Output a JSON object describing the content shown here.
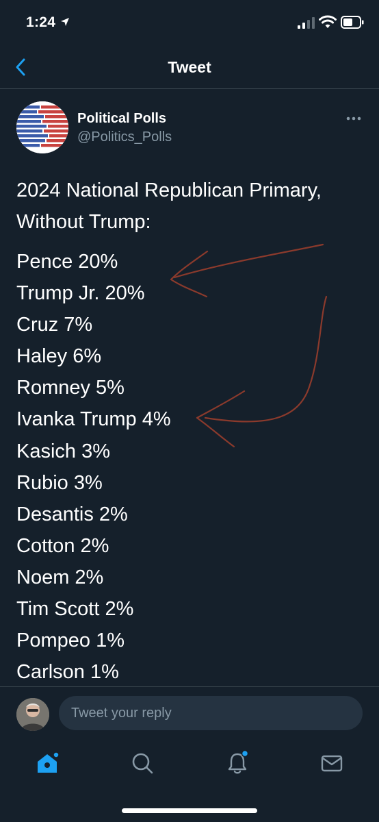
{
  "status_bar": {
    "time": "1:24"
  },
  "header": {
    "title": "Tweet"
  },
  "tweet": {
    "author_name": "Political Polls",
    "handle": "@Politics_Polls",
    "intro": "2024 National Republican Primary,\nWithout Trump:",
    "poll_lines": [
      "Pence 20%",
      "Trump Jr. 20%",
      "Cruz 7%",
      "Haley 6%",
      "Romney 5%",
      "Ivanka Trump 4%",
      "Kasich 3%",
      "Rubio 3%",
      "Desantis 2%",
      "Cotton 2%",
      "Noem 2%",
      "Tim Scott 2%",
      "Pompeo 1%",
      "Carlson 1%"
    ]
  },
  "reply": {
    "placeholder": "Tweet your reply"
  },
  "colors": {
    "background": "#15202b",
    "accent": "#1da1f2",
    "secondary_text": "#8899a6",
    "annotation": "#8b3a2c"
  },
  "icons": {
    "back": "chevron-left-icon",
    "more": "more-horizontal-icon",
    "home": "home-icon",
    "search": "search-icon",
    "notifications": "bell-icon",
    "messages": "mail-icon"
  }
}
